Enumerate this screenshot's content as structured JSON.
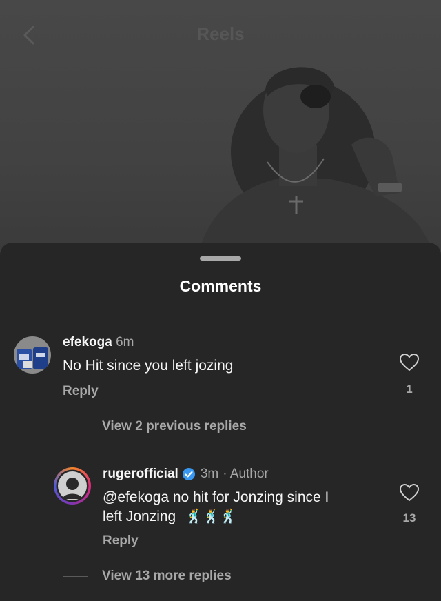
{
  "header": {
    "title": "Reels"
  },
  "sheet": {
    "title": "Comments"
  },
  "comments": [
    {
      "username": "efekoga",
      "time": "6m",
      "text": "No Hit since you left jozing",
      "reply_label": "Reply",
      "likes": "1",
      "view_replies": "View 2 previous replies"
    },
    {
      "username": "rugerofficial",
      "verified": true,
      "time": "3m",
      "author_label": "· Author",
      "text_line1": "@efekoga no hit for Jonzing since I",
      "text_line2": "left Jonzing",
      "emojis": "🕺🕺🕺",
      "reply_label": "Reply",
      "likes": "13",
      "view_replies": "View 13 more replies"
    }
  ],
  "colors": {
    "background": "#262626",
    "text_primary": "#f5f5f5",
    "text_secondary": "#a8a8a8",
    "verified_blue": "#3897f0"
  },
  "icons": [
    "back-arrow-icon",
    "heart-icon",
    "verified-badge-icon",
    "dancer-emoji-icon"
  ]
}
